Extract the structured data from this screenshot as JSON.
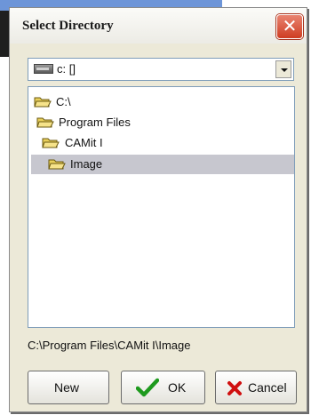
{
  "dialog": {
    "title": "Select Directory",
    "close_icon": "close-icon"
  },
  "drive_select": {
    "value": "c: []",
    "icon": "drive-icon"
  },
  "tree": {
    "items": [
      {
        "label": "C:\\",
        "icon": "open-folder-icon",
        "level": 0,
        "selected": false
      },
      {
        "label": "Program Files",
        "icon": "open-folder-icon",
        "level": 1,
        "selected": false
      },
      {
        "label": "CAMit I",
        "icon": "open-folder-icon",
        "level": 2,
        "selected": false
      },
      {
        "label": "Image",
        "icon": "open-folder-icon",
        "level": 3,
        "selected": true
      }
    ]
  },
  "current_path": "C:\\Program Files\\CAMit I\\Image",
  "buttons": {
    "new_label": "New",
    "ok_label": "OK",
    "ok_icon": "checkmark-icon",
    "cancel_label": "Cancel",
    "cancel_icon": "x-icon"
  },
  "colors": {
    "dialog_bg": "#ece9d8",
    "close_button": "#cf3d22",
    "selection": "#c7c7cf",
    "folder": "#e8cf5a",
    "ok_check": "#1e9a1e",
    "cancel_x": "#d01010"
  }
}
